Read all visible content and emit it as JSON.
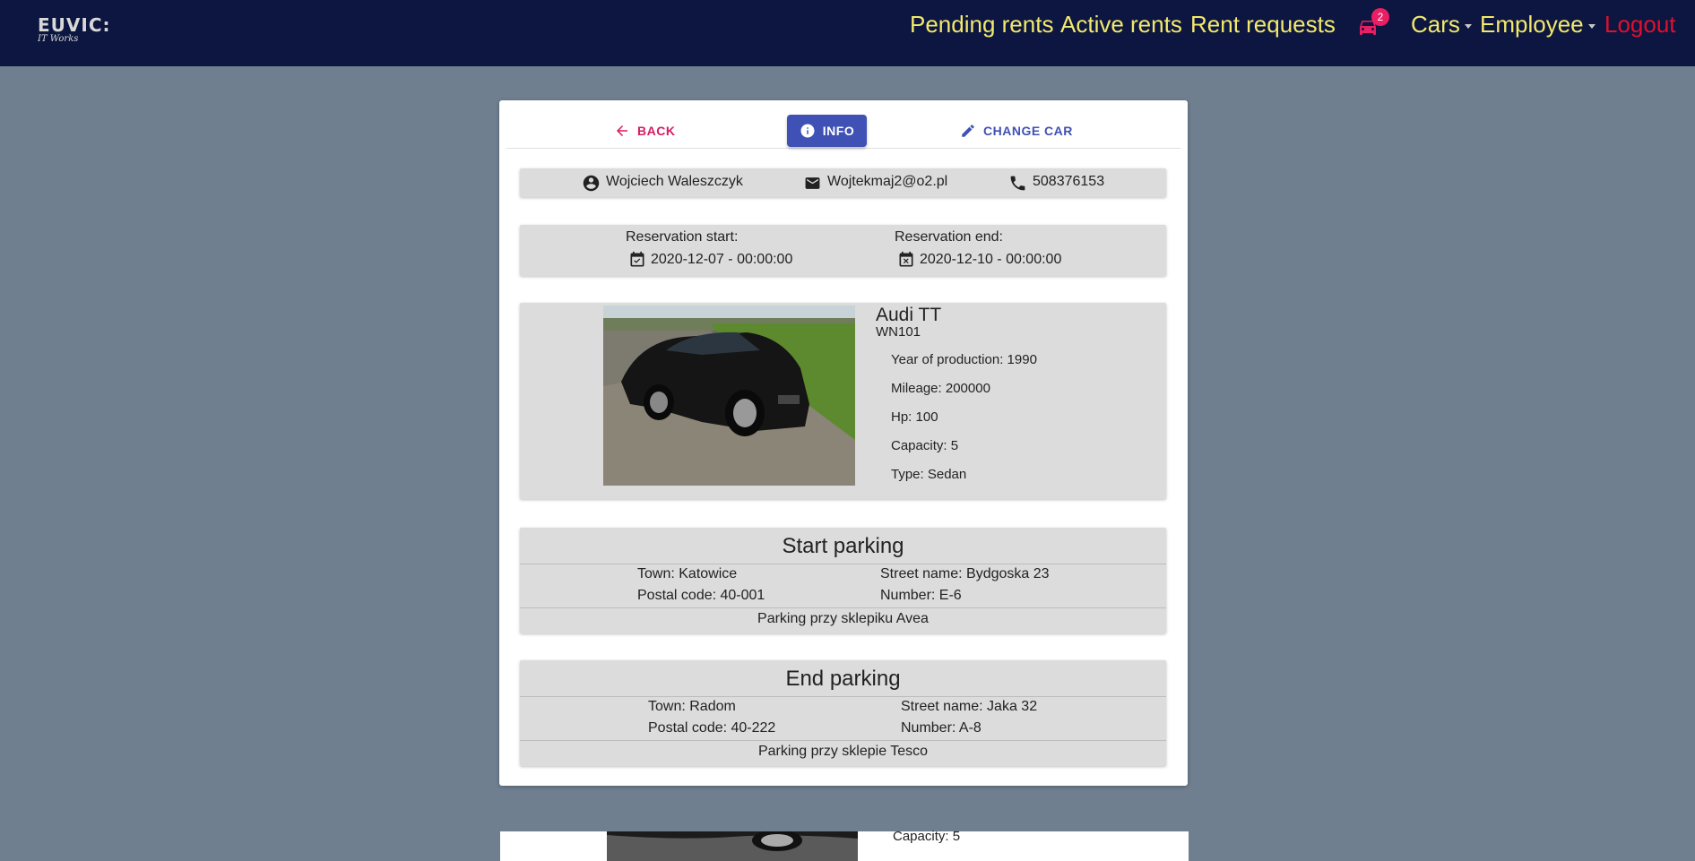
{
  "navbar": {
    "logo_main": "EUVIC:",
    "logo_sub": "IT Works",
    "links": {
      "pending": "Pending rents",
      "active": "Active rents",
      "requests": "Rent requests",
      "cars": "Cars",
      "employee": "Employee",
      "logout": "Logout"
    },
    "notification_count": "2",
    "colors": {
      "background": "#0c1640",
      "link": "#f3e96b",
      "logout": "#e0102e",
      "badge": "#e91e63"
    }
  },
  "actions": {
    "back": "BACK",
    "info": "INFO",
    "change_car": "CHANGE CAR"
  },
  "client": {
    "name": "Wojciech Waleszczyk",
    "email": "Wojtekmaj2@o2.pl",
    "phone": "508376153"
  },
  "reservation": {
    "start_label": "Reservation start:",
    "start_value": "2020-12-07 - 00:00:00",
    "end_label": "Reservation end:",
    "end_value": "2020-12-10 - 00:00:00"
  },
  "car": {
    "model": "Audi TT",
    "plate": "WN101",
    "year": "Year of production: 1990",
    "mileage": "Mileage: 200000",
    "hp": "Hp: 100",
    "capacity": "Capacity: 5",
    "type": "Type: Sedan"
  },
  "start_parking": {
    "title": "Start parking",
    "town": "Town: Katowice",
    "postal": "Postal code: 40-001",
    "street": "Street name: Bydgoska 23",
    "number": "Number: E-6",
    "description": "Parking przy sklepiku Avea"
  },
  "end_parking": {
    "title": "End parking",
    "town": "Town: Radom",
    "postal": "Postal code: 40-222",
    "street": "Street name: Jaka 32",
    "number": "Number: A-8",
    "description": "Parking przy sklepie Tesco"
  },
  "next_card": {
    "capacity": "Capacity: 5"
  }
}
